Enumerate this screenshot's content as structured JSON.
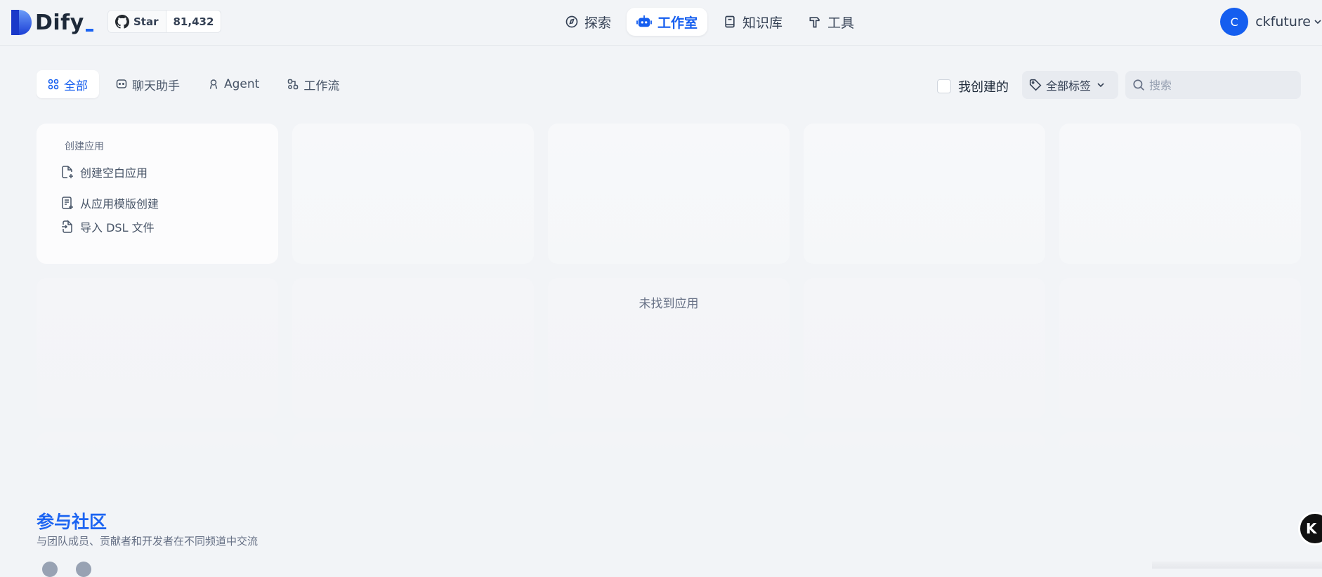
{
  "header": {
    "logo_text": "Dify",
    "github": {
      "star_label": "Star",
      "star_count": "81,432"
    },
    "nav": [
      {
        "label": "探索",
        "icon": "compass-icon"
      },
      {
        "label": "工作室",
        "icon": "robot-icon"
      },
      {
        "label": "知识库",
        "icon": "book-icon"
      },
      {
        "label": "工具",
        "icon": "hammer-icon"
      }
    ],
    "user": {
      "initial": "C",
      "name": "ckfuture"
    }
  },
  "filters": {
    "tabs": [
      {
        "label": "全部",
        "icon": "grid-icon"
      },
      {
        "label": "聊天助手",
        "icon": "chat-icon"
      },
      {
        "label": "Agent",
        "icon": "agent-icon"
      },
      {
        "label": "工作流",
        "icon": "workflow-icon"
      }
    ],
    "mine_label": "我创建的",
    "tag_label": "全部标签",
    "search_placeholder": "搜索"
  },
  "create_card": {
    "title": "创建应用",
    "items": [
      {
        "label": "创建空白应用",
        "icon": "file-plus-icon"
      },
      {
        "label": "从应用模版创建",
        "icon": "template-icon"
      },
      {
        "label": "导入 DSL 文件",
        "icon": "import-icon"
      }
    ]
  },
  "empty_text": "未找到应用",
  "community": {
    "title": "参与社区",
    "description": "与团队成员、贡献者和开发者在不同频道中交流"
  },
  "colors": {
    "accent": "#155eef",
    "background": "#f2f4f7",
    "community_title": "#1c64f2"
  }
}
